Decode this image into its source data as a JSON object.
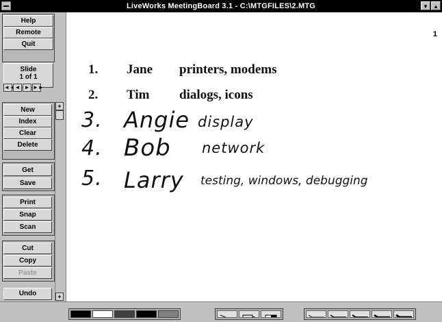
{
  "window": {
    "title": "LiveWorks MeetingBoard 3.1 - C:\\MTGFILES\\2.MTG",
    "minimize_glyph": "▼",
    "maximize_glyph": "▲"
  },
  "toolbar": {
    "help": "Help",
    "remote": "Remote",
    "quit": "Quit",
    "slide_label": "Slide",
    "slide_count": "1 of 1",
    "nav": [
      "◄◄",
      "◄",
      "►",
      "►►"
    ],
    "new": "New",
    "index": "Index",
    "clear": "Clear",
    "delete": "Delete",
    "get": "Get",
    "save": "Save",
    "print": "Print",
    "snap": "Snap",
    "scan": "Scan",
    "cut": "Cut",
    "copy": "Copy",
    "paste": "Paste",
    "undo": "Undo",
    "scroll_up": "+",
    "scroll_down": "+"
  },
  "board": {
    "page_number": "1",
    "typed_items": [
      {
        "num": "1.",
        "name": "Jane",
        "topic": "printers, modems"
      },
      {
        "num": "2.",
        "name": "Tim",
        "topic": "dialogs, icons"
      }
    ],
    "handwritten_items": [
      {
        "num": "3.",
        "name": "Angie",
        "topic": "display"
      },
      {
        "num": "4.",
        "name": "Bob",
        "topic": "network"
      },
      {
        "num": "5.",
        "name": "Larry",
        "topic": "testing, windows, debugging"
      }
    ]
  },
  "palette": {
    "colors": [
      "#000000",
      "#ffffff",
      "#404040",
      "#000000",
      "#808080"
    ],
    "tools": [
      "pen-tool",
      "marker-tool",
      "eraser-tool"
    ],
    "line_widths": [
      "thin",
      "medium",
      "thick",
      "thicker",
      "thickest"
    ]
  }
}
